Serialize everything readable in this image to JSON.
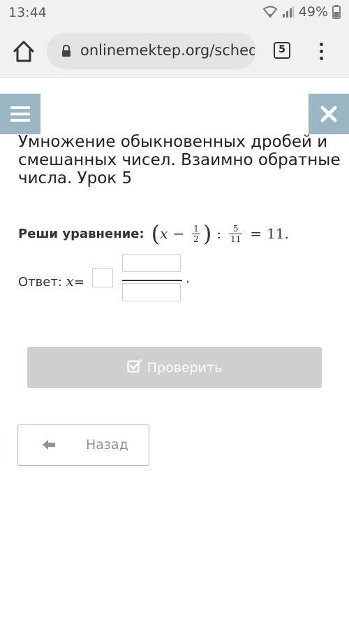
{
  "status_bar": {
    "time": "13:44",
    "battery": "49%"
  },
  "browser": {
    "url": "onlinemektep.org/schedule",
    "tab_count": "5"
  },
  "lesson": {
    "title": "Умножение обыкновенных дробей и смешанных чисел. Взаимно обратные числа. Урок 5"
  },
  "task": {
    "label": "Реши уравнение:",
    "equation": {
      "var": "x",
      "minus": "−",
      "frac1_num": "1",
      "frac1_den": "2",
      "divide": ":",
      "frac2_num": "5",
      "frac2_den": "11",
      "equals": "=",
      "result": "11."
    }
  },
  "answer": {
    "label": "Ответ:",
    "var": "x",
    "equals": "=",
    "dot": "."
  },
  "buttons": {
    "check": "Проверить",
    "back": "Назад"
  }
}
